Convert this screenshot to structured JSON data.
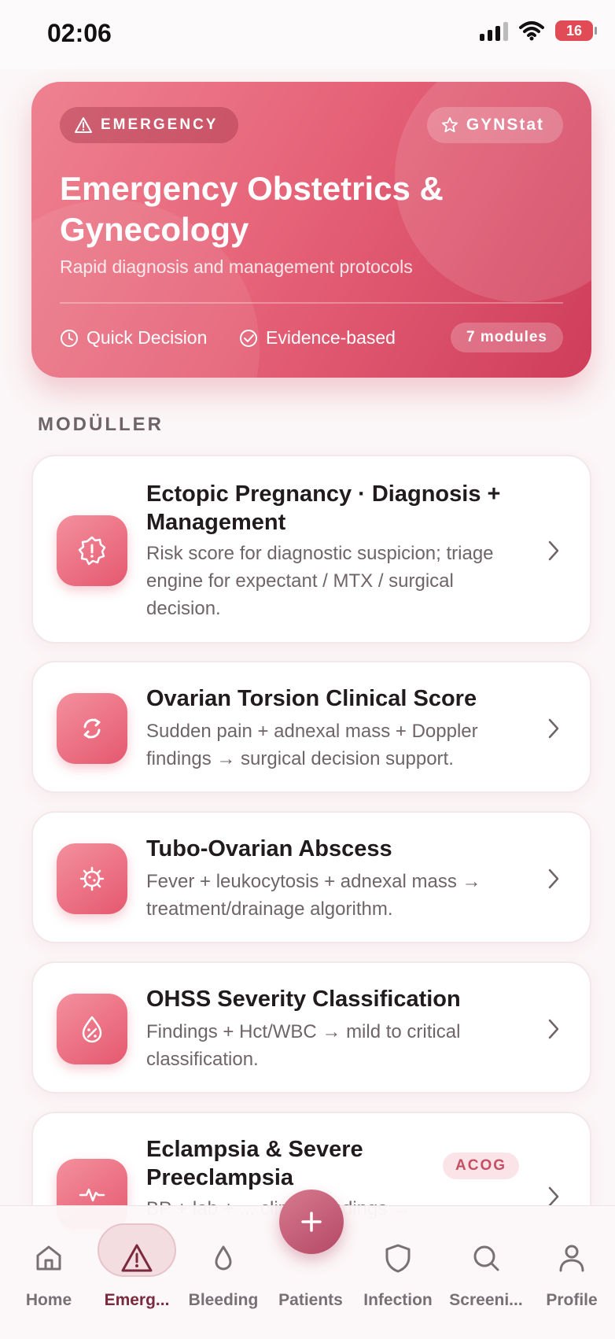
{
  "status_bar": {
    "time": "02:06",
    "battery": "16"
  },
  "hero": {
    "badge": "EMERGENCY",
    "brand": "GYNStat",
    "title": "Emergency Obstetrics & Gynecology",
    "subtitle": "Rapid diagnosis and management protocols",
    "feature_1": "Quick Decision",
    "feature_2": "Evidence-based",
    "modules": "7 modules"
  },
  "section_label": "MODÜLLER",
  "modules": [
    {
      "title": "Ectopic Pregnancy · Diagnosis + Management",
      "description": "Risk score for diagnostic suspicion; triage engine for expectant / MTX / surgical decision.",
      "icon": "alert-badge-icon"
    },
    {
      "title": "Ovarian Torsion Clinical Score",
      "description": "Sudden pain + adnexal mass + Doppler findings → surgical decision support.",
      "icon": "rotate-arrows-icon"
    },
    {
      "title": "Tubo-Ovarian Abscess",
      "description": "Fever + leukocytosis + adnexal mass → treatment/drainage algorithm.",
      "icon": "bacteria-icon"
    },
    {
      "title": "OHSS Severity Classification",
      "description": "Findings + Hct/WBC → mild to critical classification.",
      "icon": "droplet-percent-icon"
    },
    {
      "title": "Eclampsia & Severe Preeclampsia",
      "tag": "ACOG",
      "description": "BP + lab + ... clinical findings →",
      "icon": "heartbeat-icon"
    }
  ],
  "tabs": [
    {
      "label": "Home",
      "icon": "home-icon"
    },
    {
      "label": "Emerg...",
      "icon": "warning-icon"
    },
    {
      "label": "Bleeding",
      "icon": "droplet-icon"
    },
    {
      "label": "Patients",
      "icon": "plus-icon"
    },
    {
      "label": "Infection",
      "icon": "shield-icon"
    },
    {
      "label": "Screeni...",
      "icon": "search-icon"
    },
    {
      "label": "Profile",
      "icon": "person-icon"
    }
  ],
  "colors": {
    "accent": "#e5586f",
    "active_tab": "#7a2a3c"
  }
}
